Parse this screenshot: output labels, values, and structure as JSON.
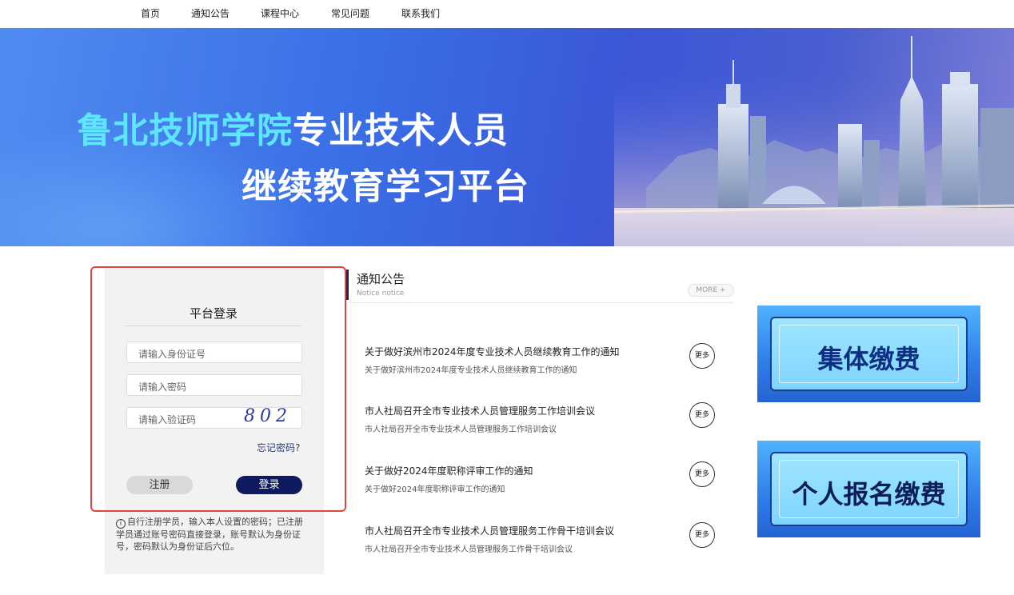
{
  "nav": {
    "items": [
      "首页",
      "通知公告",
      "课程中心",
      "常见问题",
      "联系我们"
    ]
  },
  "banner": {
    "title_part1": "鲁北技师学院",
    "title_part2": "专业技术人员",
    "title_line2": "继续教育学习平台"
  },
  "login": {
    "title": "平台登录",
    "id_placeholder": "请输入身份证号",
    "password_placeholder": "请输入密码",
    "captcha_placeholder": "请输入验证码",
    "captcha_code": "802",
    "forgot_label": "忘记密码?",
    "register_label": "注册",
    "login_label": "登录",
    "info_icon": "info-icon",
    "hint": "自行注册学员，输入本人设置的密码；已注册学员通过账号密码直接登录，账号默认为身份证号，密码默认为身份证后六位。"
  },
  "notices": {
    "title": "通知公告",
    "subtitle": "Notice notice",
    "more_label": "MORE +",
    "item_more_label": "更多",
    "items": [
      {
        "title": "关于做好滨州市2024年度专业技术人员继续教育工作的通知",
        "summary": "关于做好滨州市2024年度专业技术人员继续教育工作的通知"
      },
      {
        "title": "市人社局召开全市专业技术人员管理服务工作培训会议",
        "summary": "市人社局召开全市专业技术人员管理服务工作培训会议"
      },
      {
        "title": "关于做好2024年度职称评审工作的通知",
        "summary": "关于做好2024年度职称评审工作的通知"
      },
      {
        "title": "市人社局召开全市专业技术人员管理服务工作骨干培训会议",
        "summary": "市人社局召开全市专业技术人员管理服务工作骨干培训会议"
      }
    ]
  },
  "promos": {
    "group_payment": "集体缴费",
    "individual_payment": "个人报名缴费"
  },
  "colors": {
    "nav_dark": "#0f1a5e",
    "highlight_frame": "#e0473a",
    "banner_title_accent": "#5ee6ff"
  }
}
